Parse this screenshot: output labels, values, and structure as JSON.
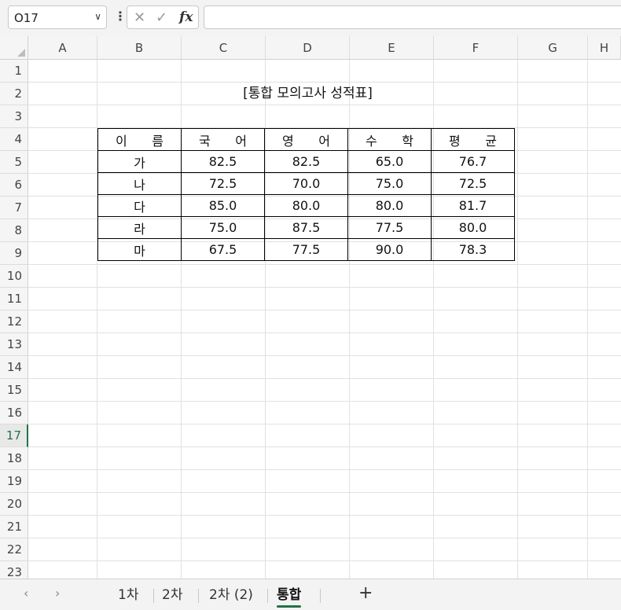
{
  "name_box": {
    "value": "O17"
  },
  "formula_bar": {
    "cancel_glyph": "✕",
    "enter_glyph": "✓",
    "fx_label": "fx",
    "value": ""
  },
  "columns": [
    "A",
    "B",
    "C",
    "D",
    "E",
    "F",
    "G",
    "H"
  ],
  "rows": [
    "1",
    "2",
    "3",
    "4",
    "5",
    "6",
    "7",
    "8",
    "9",
    "10",
    "11",
    "12",
    "13",
    "14",
    "15",
    "16",
    "17",
    "18",
    "19",
    "20",
    "21",
    "22",
    "23"
  ],
  "selected_row": "17",
  "sheet": {
    "title": "[통합 모의고사 성적표]",
    "headers": [
      [
        "이",
        "름"
      ],
      [
        "국",
        "어"
      ],
      [
        "영",
        "어"
      ],
      [
        "수",
        "학"
      ],
      [
        "평",
        "균"
      ]
    ],
    "rows": [
      [
        "가",
        "82.5",
        "82.5",
        "65.0",
        "76.7"
      ],
      [
        "나",
        "72.5",
        "70.0",
        "75.0",
        "72.5"
      ],
      [
        "다",
        "85.0",
        "80.0",
        "80.0",
        "81.7"
      ],
      [
        "라",
        "75.0",
        "87.5",
        "77.5",
        "80.0"
      ],
      [
        "마",
        "67.5",
        "77.5",
        "90.0",
        "78.3"
      ]
    ]
  },
  "tabs": {
    "prev_glyph": "‹",
    "next_glyph": "›",
    "items": [
      "1차",
      "2차",
      "2차 (2)",
      "통합"
    ],
    "active": "통합",
    "add_glyph": "+"
  }
}
